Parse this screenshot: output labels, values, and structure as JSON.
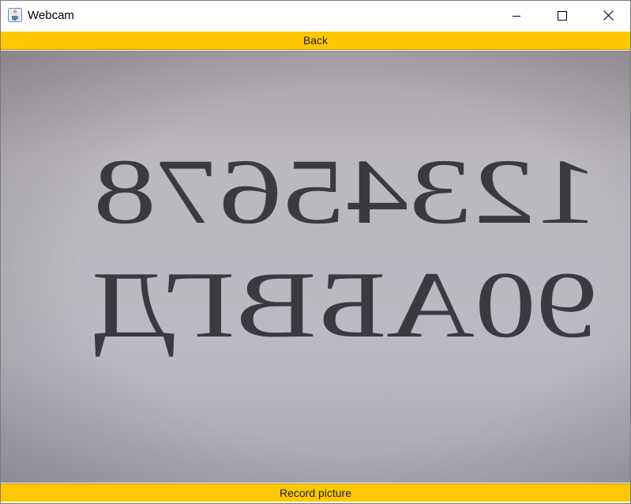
{
  "window": {
    "title": "Webcam",
    "app_icon": "java-cup-icon",
    "controls": {
      "minimize_icon": "minimize-icon",
      "maximize_icon": "maximize-icon",
      "close_icon": "close-icon"
    }
  },
  "buttons": {
    "back_label": "Back",
    "record_label": "Record picture",
    "color": "#ffc700"
  },
  "camera": {
    "line1": "12345678",
    "line2": "90АБВГД",
    "mirrored": true,
    "paper_color": "#b9b6bd",
    "ink_color": "#3a3a40"
  }
}
